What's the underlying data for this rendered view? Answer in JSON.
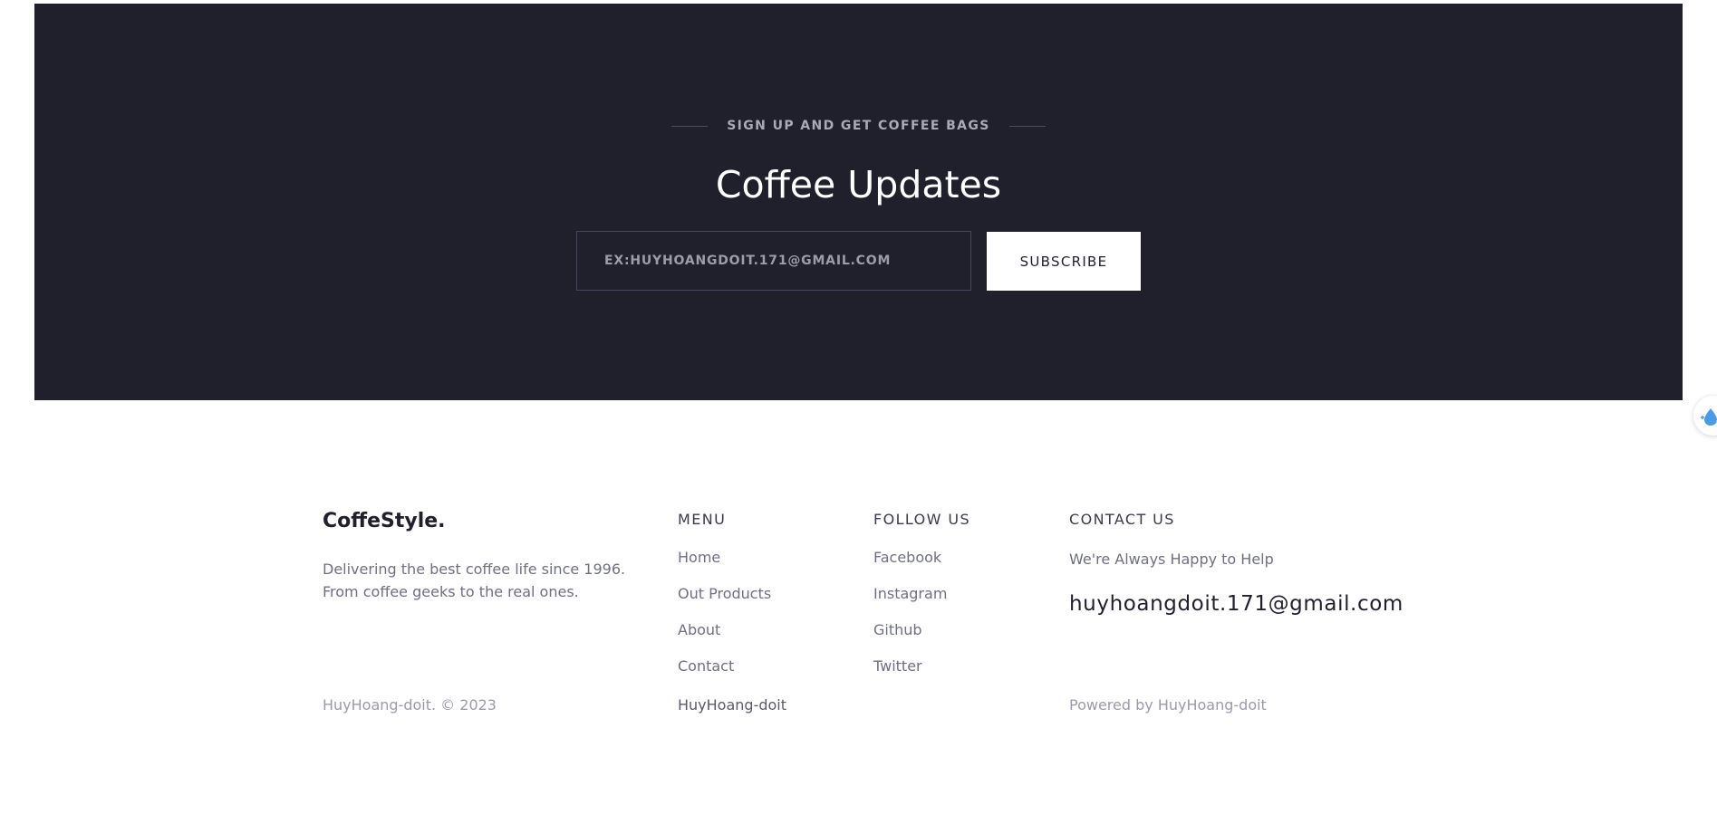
{
  "newsletter": {
    "eyebrow": "SIGN UP AND GET COFFEE BAGS",
    "headline": "Coffee Updates",
    "email_placeholder": "EX:HUYHOANGDOIT.171@GMAIL.COM",
    "subscribe_label": "SUBSCRIBE"
  },
  "side_widget": {
    "icon": "water-drop-icon"
  },
  "footer": {
    "brand": "CoffeStyle.",
    "tagline": "Delivering the best coffee life since 1996. From coffee geeks to the real ones.",
    "copyright": "HuyHoang-doit. © 2023",
    "menu": {
      "heading": "MENU",
      "items": [
        "Home",
        "Out Products",
        "About",
        "Contact"
      ]
    },
    "follow": {
      "heading": "FOLLOW US",
      "items": [
        "Facebook",
        "Instagram",
        "Github",
        "Twitter"
      ]
    },
    "contact": {
      "heading": "CONTACT US",
      "text": "We're Always Happy to Help",
      "email": "huyhoangdoit.171@gmail.com"
    },
    "author_link": "HuyHoang-doit",
    "powered_by": "Powered by HuyHoang-doit"
  },
  "colors": {
    "dark_band": "#1f202c",
    "text_muted": "#6f7080",
    "text_dark": "#1f202c",
    "accent_drop": "#4a9be6"
  }
}
